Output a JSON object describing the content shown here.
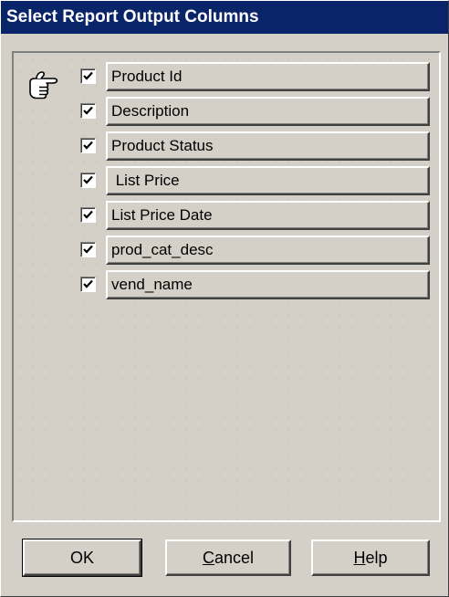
{
  "window": {
    "title": "Select Report Output Columns"
  },
  "pointer": {
    "icon": "pointing-hand-icon"
  },
  "columns": [
    {
      "label": "Product Id",
      "checked": true
    },
    {
      "label": "Description",
      "checked": true
    },
    {
      "label": "Product Status",
      "checked": true
    },
    {
      "label": " List Price",
      "checked": true
    },
    {
      "label": "List Price Date",
      "checked": true
    },
    {
      "label": "prod_cat_desc",
      "checked": true
    },
    {
      "label": "vend_name",
      "checked": true
    }
  ],
  "buttons": {
    "ok": "OK",
    "cancel": {
      "mnemonic": "C",
      "rest": "ancel"
    },
    "help": {
      "mnemonic": "H",
      "rest": "elp"
    }
  },
  "colors": {
    "titlebar": "#0a246a",
    "face": "#d4d0c8"
  }
}
